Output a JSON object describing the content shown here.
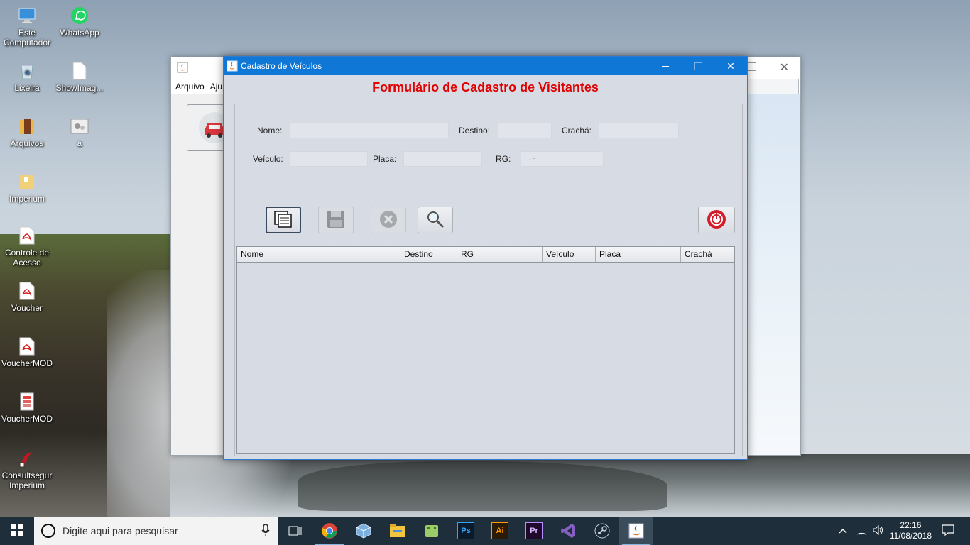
{
  "desktop": {
    "icons": [
      {
        "label": "Este Computador",
        "icon": "computer-icon"
      },
      {
        "label": "WhatsApp",
        "icon": "whatsapp-icon"
      },
      {
        "label": "Lixeira",
        "icon": "recycle-bin-icon"
      },
      {
        "label": "ShowImag...",
        "icon": "file-icon"
      },
      {
        "label": "Arquivos",
        "icon": "folder-icon"
      },
      {
        "label": "a",
        "icon": "settings-file-icon"
      },
      {
        "label": "Imperium",
        "icon": "folder-icon"
      },
      {
        "label": "Controle de Acesso",
        "icon": "pdf-icon"
      },
      {
        "label": "Voucher",
        "icon": "pdf-icon"
      },
      {
        "label": "VoucherMOD",
        "icon": "pdf-icon"
      },
      {
        "label": "VoucherMOD",
        "icon": "document-icon"
      },
      {
        "label": "Consultsegur Imperium",
        "icon": "shortcut-icon"
      }
    ]
  },
  "back_window": {
    "menu": [
      "Arquivo",
      "Aju"
    ]
  },
  "window": {
    "title": "Cadastro de Veículos",
    "form_title": "Formulário de Cadastro de Visitantes",
    "labels": {
      "nome": "Nome:",
      "destino": "Destino:",
      "cracha": "Crachá:",
      "veiculo": "Veículo:",
      "placa": "Placa:",
      "rg": "RG:"
    },
    "fields": {
      "nome": "",
      "destino": "",
      "cracha": "",
      "veiculo": "",
      "placa": "",
      "rg": " .   .   -"
    },
    "table": {
      "columns": [
        "Nome",
        "Destino",
        "RG",
        "Veículo",
        "Placa",
        "Crachá"
      ],
      "rows": []
    }
  },
  "taskbar": {
    "search_placeholder": "Digite aqui para pesquisar",
    "apps": [
      "task-view-icon",
      "chrome-icon",
      "virtualbox-icon",
      "file-explorer-icon",
      "android-icon",
      "photoshop-icon",
      "illustrator-icon",
      "premiere-icon",
      "visual-studio-icon",
      "steam-icon",
      "java-icon"
    ],
    "app_labels": {
      "ps": "Ps",
      "ai": "Ai",
      "pr": "Pr"
    },
    "time": "22:16",
    "date": "11/08/2018"
  }
}
